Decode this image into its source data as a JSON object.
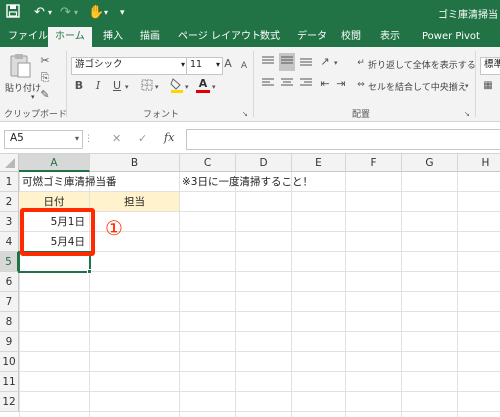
{
  "quick_access": {
    "save_icon": "save-icon",
    "undo_icon": "undo-icon",
    "redo_icon": "redo-icon",
    "touch_icon": "touch-mode-icon",
    "more_icon": "customize-icon"
  },
  "window_title": "ゴミ庫清掃当",
  "tabs": [
    {
      "label": "ファイル"
    },
    {
      "label": "ホーム"
    },
    {
      "label": "挿入"
    },
    {
      "label": "描画"
    },
    {
      "label": "ページ レイアウト"
    },
    {
      "label": "数式"
    },
    {
      "label": "データ"
    },
    {
      "label": "校閲"
    },
    {
      "label": "表示"
    },
    {
      "label": "Power Pivot"
    }
  ],
  "ribbon": {
    "paste_label": "貼り付け",
    "clipboard_group": "クリップボード",
    "font_name": "游ゴシック",
    "font_size": "11",
    "font_group": "フォント",
    "bold": "B",
    "italic": "I",
    "underline": "U",
    "grow_font": "A",
    "shrink_font": "A",
    "wrap_text": "折り返して全体を表示する",
    "merge_center": "セルを結合して中央揃え",
    "alignment_group": "配置",
    "number_format": "標準",
    "font_color": "#e00000",
    "fill_color": "#ffd700"
  },
  "formula_bar": {
    "name_box": "A5",
    "fx": "fx",
    "cancel": "✕",
    "enter": "✓",
    "formula": ""
  },
  "columns": [
    "A",
    "B",
    "C",
    "D",
    "E",
    "F",
    "G",
    "H"
  ],
  "rows": [
    "1",
    "2",
    "3",
    "4",
    "5",
    "6",
    "7",
    "8",
    "9",
    "10",
    "11",
    "12"
  ],
  "cells": {
    "A1": "可燃ゴミ庫清掃当番",
    "C1": "※3日に一度清掃すること！",
    "A2": "日付",
    "B2": "担当",
    "A3": "5月1日",
    "A4": "5月4日"
  },
  "annotation": {
    "marker": "①",
    "color": "#ff2a00"
  },
  "header_fill_color": "#fff2cc",
  "accent_color": "#217346"
}
